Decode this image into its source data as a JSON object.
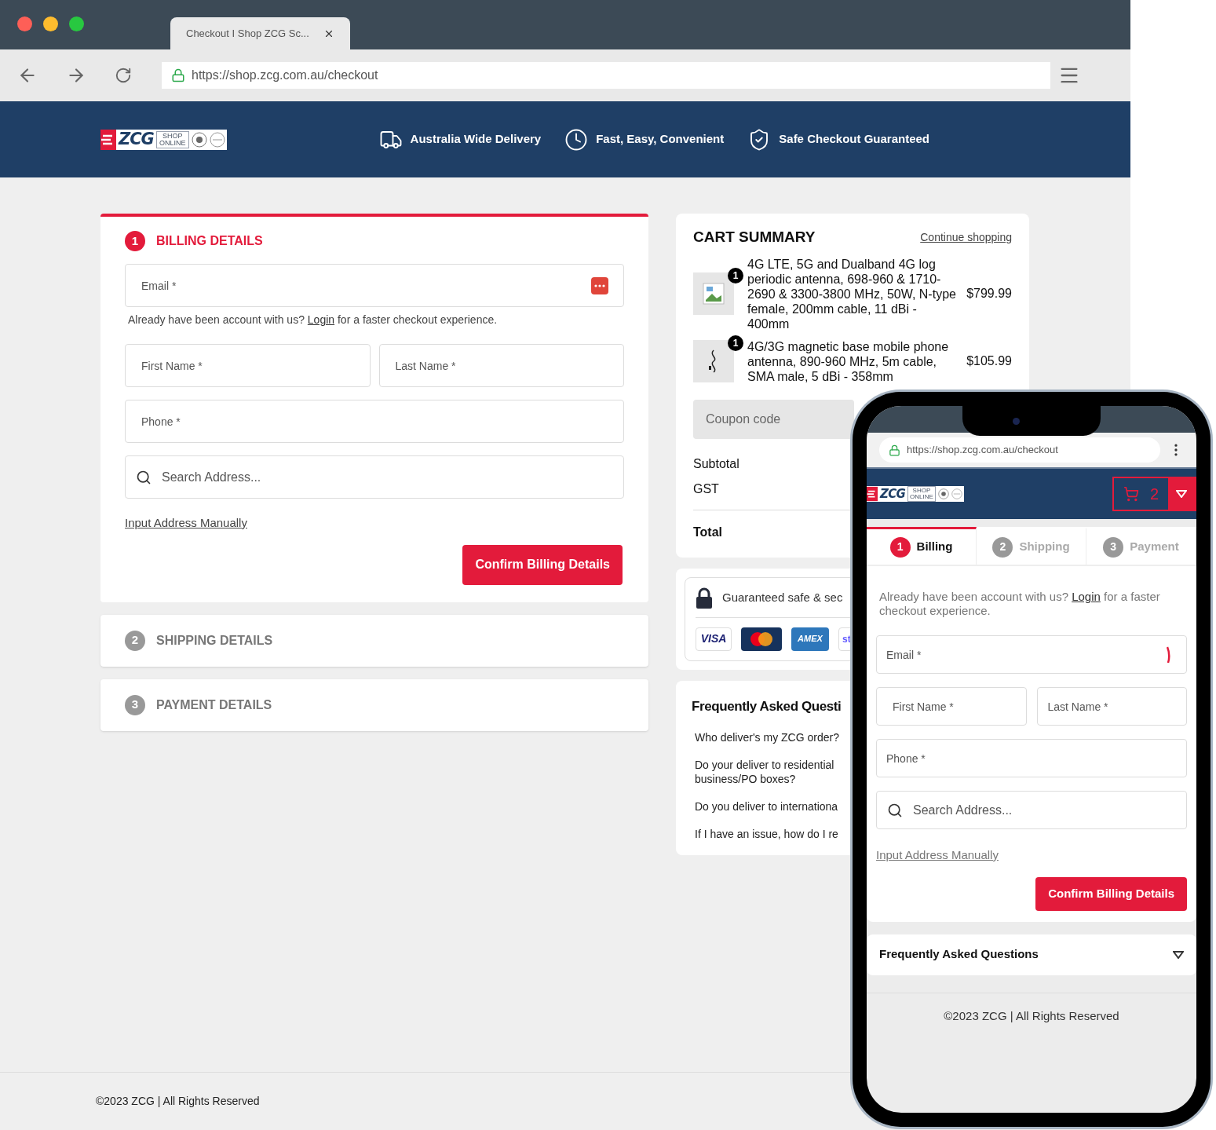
{
  "browser": {
    "tab_title": "Checkout I Shop ZCG Sc...",
    "url": "https://shop.zcg.com.au/checkout"
  },
  "header": {
    "logo": {
      "name": "ZCG",
      "tagline": "SHOP ONLINE"
    },
    "features": [
      "Australia Wide Delivery",
      "Fast, Easy, Convenient",
      "Safe Checkout Guaranteed"
    ]
  },
  "steps": [
    {
      "number": "1",
      "title": "BILLING DETAILS",
      "expanded": true
    },
    {
      "number": "2",
      "title": "SHIPPING DETAILS",
      "expanded": false
    },
    {
      "number": "3",
      "title": "PAYMENT DETAILS",
      "expanded": false
    }
  ],
  "billing": {
    "email": {
      "placeholder": "Email *"
    },
    "login_prompt": {
      "before": "Already have been account with us?",
      "link": "Login",
      "after": "for a faster checkout experience."
    },
    "first_name": {
      "placeholder": "First Name *"
    },
    "last_name": {
      "placeholder": "Last Name *"
    },
    "phone": {
      "placeholder": "Phone *"
    },
    "address_search": {
      "placeholder": "Search Address..."
    },
    "manual_link": "Input Address Manually",
    "confirm_button": "Confirm Billing Details"
  },
  "cart": {
    "title": "CART SUMMARY",
    "continue_link": "Continue shopping",
    "items": [
      {
        "qty": "1",
        "kind": "broken",
        "name": "4G LTE, 5G and Dualband 4G log periodic antenna, 698-960 & 1710-2690 & 3300-3800 MHz, 50W, N-type female, 200mm cable, 11 dBi - 400mm",
        "price": "$799.99"
      },
      {
        "qty": "1",
        "kind": "antenna",
        "name": "4G/3G magnetic base mobile phone antenna, 890-960 MHz, 5m cable, SMA male, 5 dBi - 358mm",
        "price": "$105.99"
      }
    ],
    "coupon": {
      "placeholder": "Coupon code"
    },
    "rows": [
      "Subtotal",
      "GST"
    ],
    "total": "Total"
  },
  "secure": {
    "text": "Guaranteed safe & sec",
    "cards": [
      {
        "kind": "visa",
        "label": "VISA"
      },
      {
        "kind": "mastercard"
      },
      {
        "kind": "amex",
        "label": "AMEX"
      },
      {
        "kind": "stripe",
        "label": "st"
      }
    ]
  },
  "faq": {
    "title": "Frequently Asked Questi",
    "questions": [
      "Who deliver's my ZCG order?",
      "Do your deliver to residential business/PO boxes?",
      "Do you deliver to internationa",
      "If I have an issue, how do I re"
    ]
  },
  "footer": "©2023 ZCG | All Rights Reserved",
  "mobile": {
    "url": "https://shop.zcg.com.au/checkout",
    "logo": {
      "name": "ZCG",
      "tagline": "SHOP ONLINE"
    },
    "cart_count": "2",
    "tabs": [
      {
        "number": "1",
        "label": "Billing",
        "selected": true
      },
      {
        "number": "2",
        "label": "Shipping",
        "selected": false
      },
      {
        "number": "3",
        "label": "Payment",
        "selected": false
      }
    ],
    "login_prompt": {
      "before": "Already have been account with us?",
      "link": "Login",
      "after": "for a faster checkout experience."
    },
    "email": {
      "placeholder": "Email *"
    },
    "first_name": {
      "placeholder": "First Name *"
    },
    "last_name": {
      "placeholder": "Last Name *"
    },
    "phone": {
      "placeholder": "Phone *"
    },
    "address_search": {
      "placeholder": "Search Address..."
    },
    "manual_link": "Input Address Manually",
    "confirm_button": "Confirm Billing Details",
    "faq_title": "Frequently Asked Questions",
    "footer": "©2023 ZCG | All Rights Reserved"
  }
}
